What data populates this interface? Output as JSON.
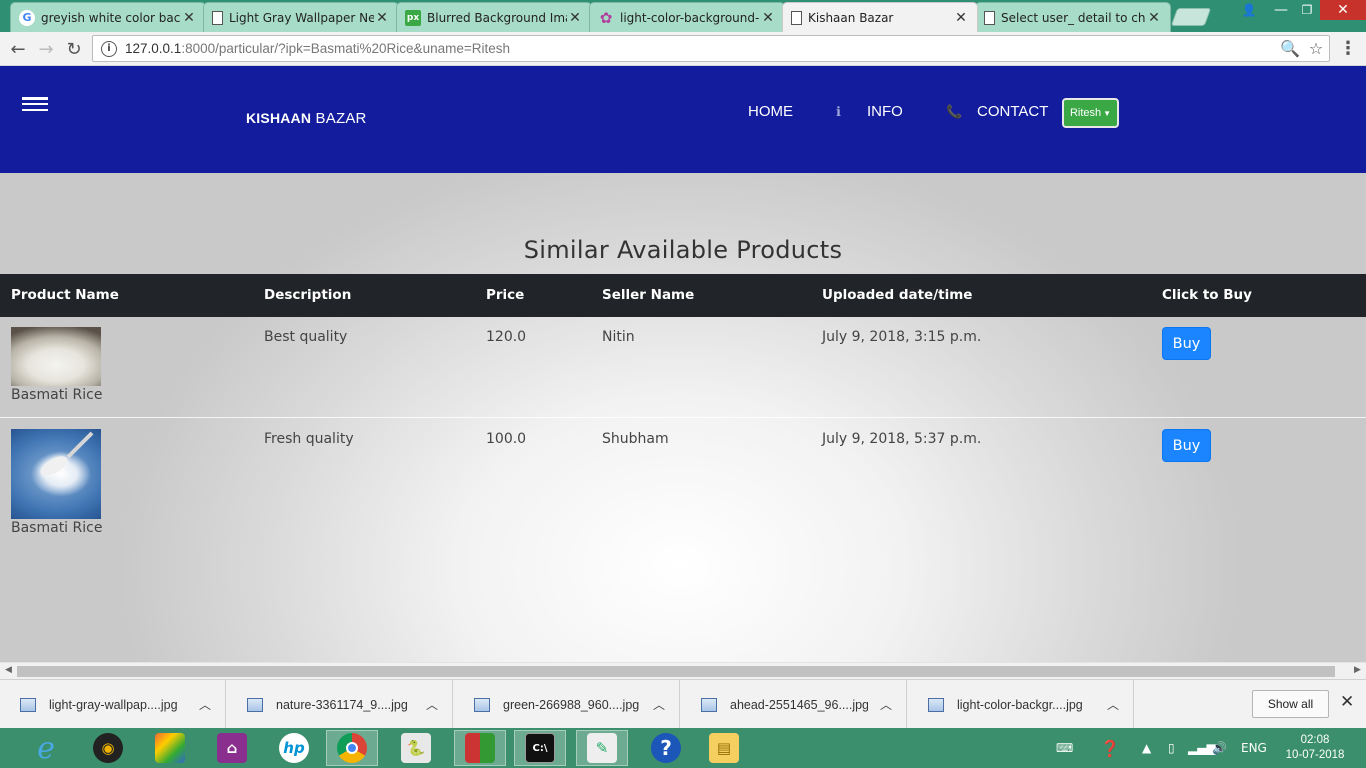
{
  "browser": {
    "tabs": [
      {
        "title": "greyish white color backg",
        "icon": "google-icon",
        "active": false
      },
      {
        "title": "Light Gray Wallpaper Nev",
        "icon": "document-icon",
        "active": false
      },
      {
        "title": "Blurred Background Imag",
        "icon": "pixabay-icon",
        "active": false
      },
      {
        "title": "light-color-background-i",
        "icon": "flower-icon",
        "active": false
      },
      {
        "title": "Kishaan Bazar",
        "icon": "document-icon",
        "active": true
      },
      {
        "title": "Select user_ detail to char",
        "icon": "document-icon",
        "active": false
      }
    ],
    "url_host": "127.0.0.1",
    "url_rest": ":8000/particular/?ipk=Basmati%20Rice&uname=Ritesh"
  },
  "site": {
    "brand_bold": "KISHAAN",
    "brand_rest": " BAZAR",
    "nav": {
      "home": "HOME",
      "info": "INFO",
      "contact": "CONTACT"
    },
    "user_button": "Ritesh",
    "brand_color": "#121c9c",
    "user_button_color": "#3aa845"
  },
  "main": {
    "heading": "Similar Available Products",
    "columns": [
      "Product Name",
      "Description",
      "Price",
      "Seller Name",
      "Uploaded date/time",
      "Click to Buy"
    ],
    "rows": [
      {
        "product": "Basmati Rice",
        "description": "Best quality",
        "price": "120.0",
        "seller": "Nitin",
        "uploaded": "July 9, 2018, 3:15 p.m.",
        "action": "Buy"
      },
      {
        "product": "Basmati Rice",
        "description": "Fresh quality",
        "price": "100.0",
        "seller": "Shubham",
        "uploaded": "July 9, 2018, 5:37 p.m.",
        "action": "Buy"
      }
    ],
    "buy_color": "#1a85ff"
  },
  "downloads": {
    "items": [
      "light-gray-wallpap....jpg",
      "nature-3361174_9....jpg",
      "green-266988_960....jpg",
      "ahead-2551465_96....jpg",
      "light-color-backgr....jpg"
    ],
    "show_all": "Show all"
  },
  "taskbar": {
    "language": "ENG",
    "time": "02:08",
    "date": "10-07-2018"
  }
}
